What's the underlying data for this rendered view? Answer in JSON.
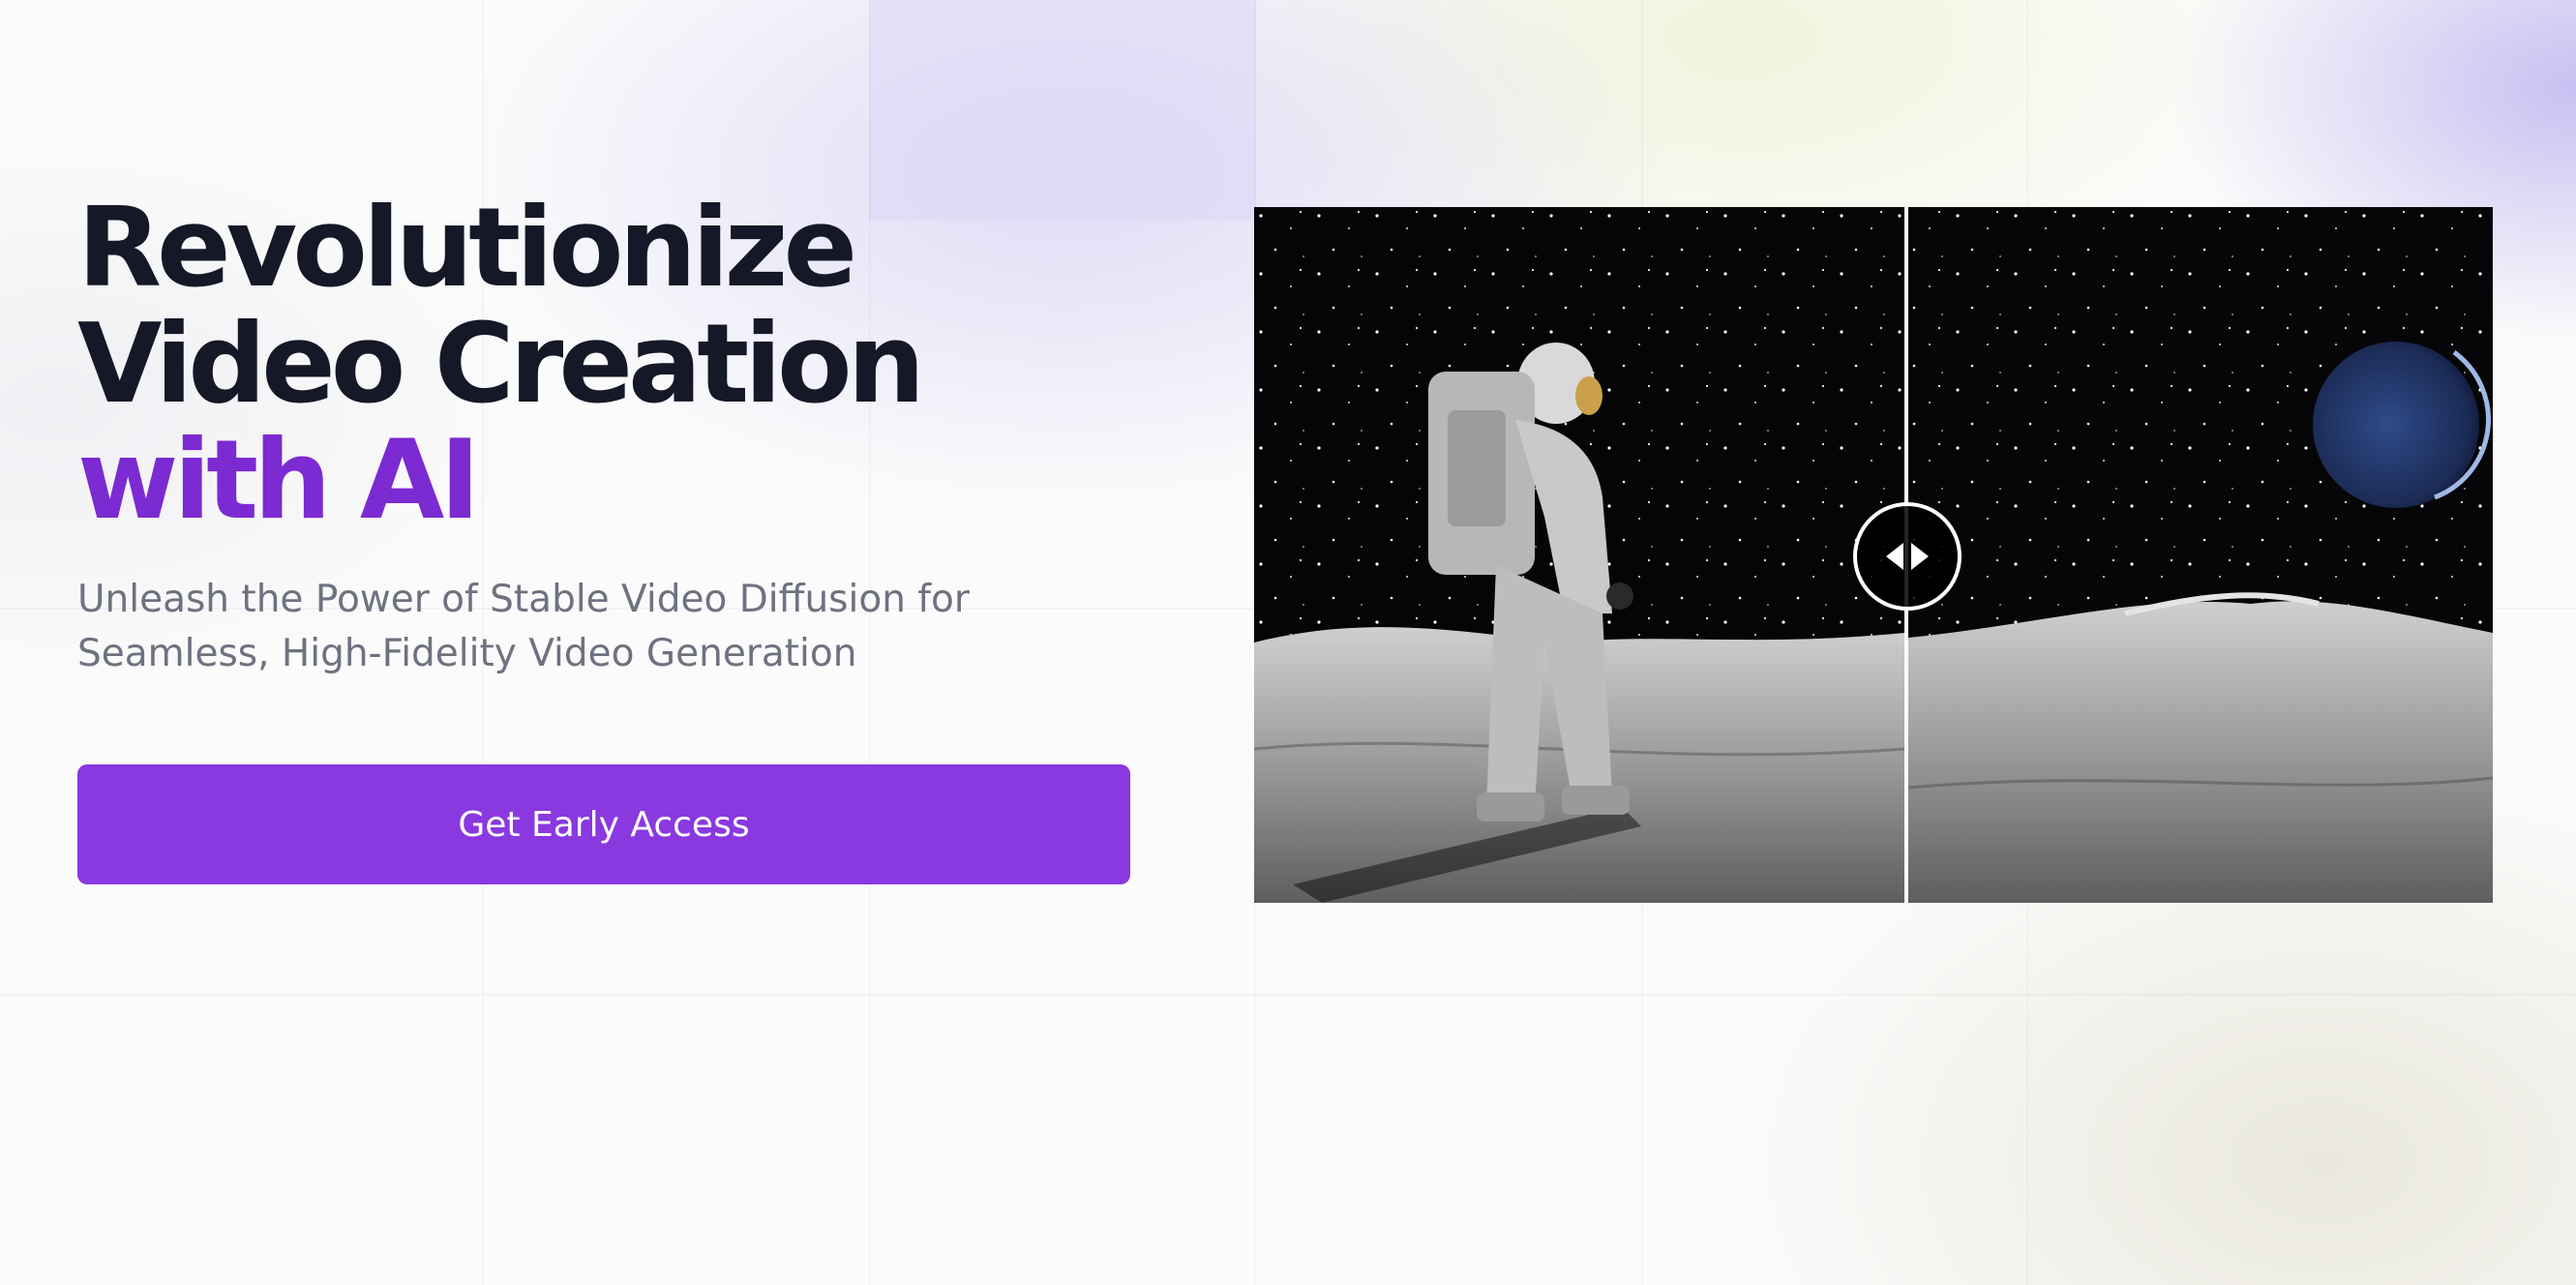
{
  "hero": {
    "headline_line1": "Revolutionize",
    "headline_line2": "Video Creation",
    "headline_accent": "with AI",
    "subheadline_line1": "Unleash the Power of Stable Video Diffusion for",
    "subheadline_line2": "Seamless, High-Fidelity Video Generation",
    "cta_label": "Get Early Access"
  },
  "comparison": {
    "left_image": "astronaut-on-moon",
    "right_image": "moon-surface-with-earth",
    "handle_icon": "left-right-arrows-icon",
    "split_position": 0.526
  },
  "colors": {
    "headline": "#141827",
    "accent": "#7c2ad1",
    "cta_background": "#8a38e0",
    "subheadline": "#6e7280"
  }
}
